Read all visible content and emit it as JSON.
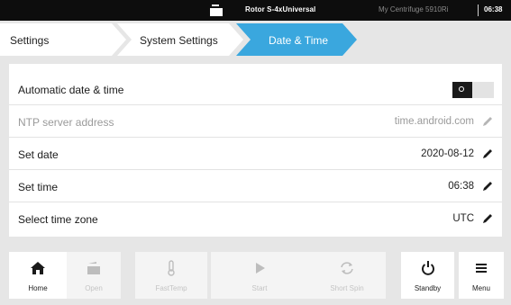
{
  "statusbar": {
    "rotor": "Rotor S-4xUniversal",
    "device": "My Centrifuge 5910Ri",
    "time": "06:38"
  },
  "breadcrumb": {
    "items": [
      "Settings",
      "System Settings",
      "Date & Time"
    ],
    "active_color": "#3aa7de"
  },
  "settings": {
    "auto_datetime": {
      "label": "Automatic date & time",
      "enabled": false
    },
    "ntp": {
      "label": "NTP server address",
      "value": "time.android.com"
    },
    "date": {
      "label": "Set date",
      "value": "2020-08-12"
    },
    "time": {
      "label": "Set time",
      "value": "06:38"
    },
    "timezone": {
      "label": "Select time zone",
      "value": "UTC"
    }
  },
  "bottombar": {
    "home": "Home",
    "open": "Open",
    "fasttemp": "FastTemp",
    "start": "Start",
    "shortspin": "Short Spin",
    "standby": "Standby",
    "menu": "Menu"
  }
}
